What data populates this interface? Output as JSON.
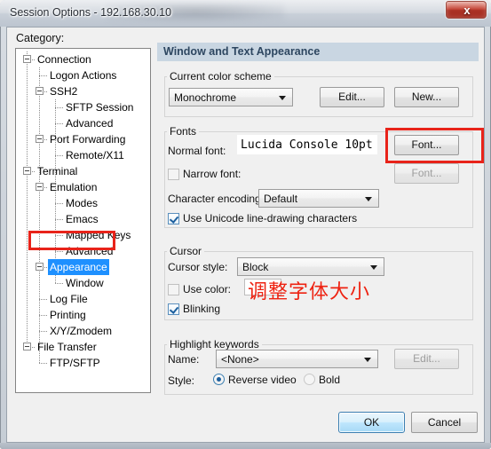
{
  "window": {
    "title": "Session Options - 192.168.30.10",
    "close_label": "x"
  },
  "sidebar": {
    "category_label": "Category:",
    "tree": [
      {
        "label": "Connection",
        "indent": 0,
        "expander": true,
        "selected": false
      },
      {
        "label": "Logon Actions",
        "indent": 1,
        "expander": false,
        "selected": false
      },
      {
        "label": "SSH2",
        "indent": 1,
        "expander": true,
        "selected": false
      },
      {
        "label": "SFTP Session",
        "indent": 2,
        "expander": false,
        "selected": false
      },
      {
        "label": "Advanced",
        "indent": 2,
        "expander": false,
        "selected": false
      },
      {
        "label": "Port Forwarding",
        "indent": 1,
        "expander": true,
        "selected": false
      },
      {
        "label": "Remote/X11",
        "indent": 2,
        "expander": false,
        "selected": false
      },
      {
        "label": "Terminal",
        "indent": 0,
        "expander": true,
        "selected": false
      },
      {
        "label": "Emulation",
        "indent": 1,
        "expander": true,
        "selected": false
      },
      {
        "label": "Modes",
        "indent": 2,
        "expander": false,
        "selected": false
      },
      {
        "label": "Emacs",
        "indent": 2,
        "expander": false,
        "selected": false
      },
      {
        "label": "Mapped Keys",
        "indent": 2,
        "expander": false,
        "selected": false
      },
      {
        "label": "Advanced",
        "indent": 2,
        "expander": false,
        "selected": false
      },
      {
        "label": "Appearance",
        "indent": 1,
        "expander": true,
        "selected": true
      },
      {
        "label": "Window",
        "indent": 2,
        "expander": false,
        "selected": false
      },
      {
        "label": "Log File",
        "indent": 1,
        "expander": false,
        "selected": false
      },
      {
        "label": "Printing",
        "indent": 1,
        "expander": false,
        "selected": false
      },
      {
        "label": "X/Y/Zmodem",
        "indent": 1,
        "expander": false,
        "selected": false
      },
      {
        "label": "File Transfer",
        "indent": 0,
        "expander": true,
        "selected": false
      },
      {
        "label": "FTP/SFTP",
        "indent": 1,
        "expander": false,
        "selected": false
      }
    ]
  },
  "main": {
    "header_title": "Window and Text Appearance",
    "color_scheme": {
      "group_title": "Current color scheme",
      "selected": "Monochrome",
      "edit_label": "Edit...",
      "new_label": "New..."
    },
    "fonts": {
      "group_title": "Fonts",
      "normal_font_label": "Normal font:",
      "normal_font_value": "Lucida Console 10pt",
      "normal_font_button": "Font...",
      "narrow_font_label": "Narrow font:",
      "narrow_font_button": "Font...",
      "narrow_font_checked": false,
      "encoding_label": "Character encoding:",
      "encoding_value": "Default",
      "unicode_label": "Use Unicode line-drawing characters",
      "unicode_checked": true
    },
    "cursor": {
      "group_title": "Cursor",
      "style_label": "Cursor style:",
      "style_value": "Block",
      "use_color_label": "Use color:",
      "use_color_checked": false,
      "blinking_label": "Blinking",
      "blinking_checked": true
    },
    "highlight": {
      "group_title": "Highlight keywords",
      "name_label": "Name:",
      "name_value": "<None>",
      "edit_label": "Edit...",
      "style_label": "Style:",
      "reverse_video_label": "Reverse video",
      "reverse_video_checked": true,
      "bold_label": "Bold",
      "bold_checked": false
    }
  },
  "footer": {
    "ok_label": "OK",
    "cancel_label": "Cancel"
  },
  "annotations": {
    "note_text": "调整字体大小",
    "accent_color": "#e8231a"
  }
}
